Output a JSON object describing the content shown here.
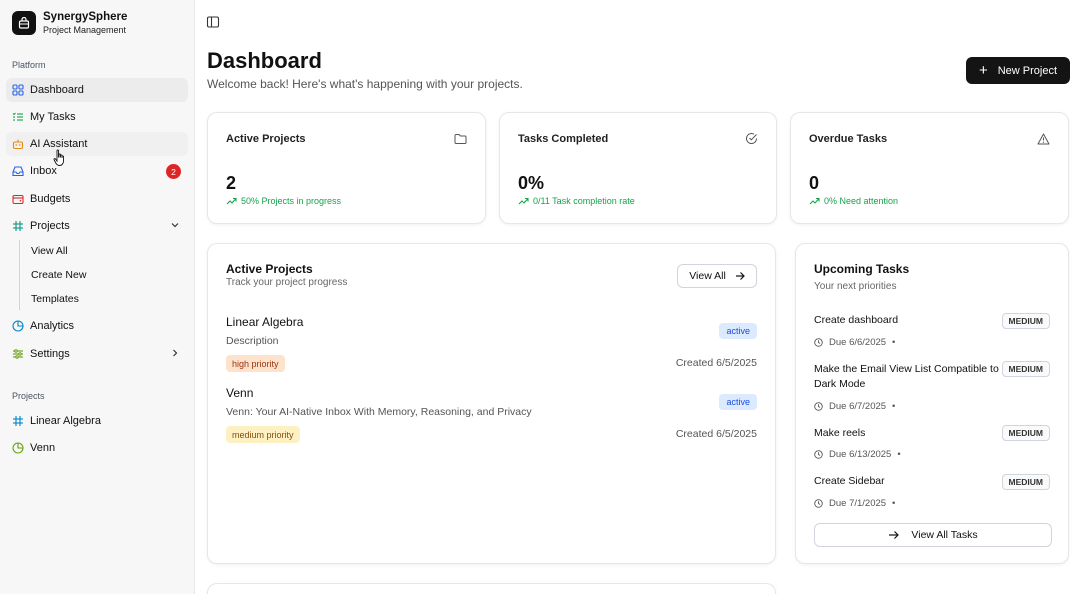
{
  "brand": {
    "name": "SynergySphere",
    "subtitle": "Project Management"
  },
  "sidebar": {
    "platform_label": "Platform",
    "items": [
      {
        "label": "Dashboard",
        "icon": "grid-icon"
      },
      {
        "label": "My Tasks",
        "icon": "list-icon"
      },
      {
        "label": "AI Assistant",
        "icon": "bot-icon"
      },
      {
        "label": "Inbox",
        "icon": "inbox-icon",
        "badge": "2"
      },
      {
        "label": "Budgets",
        "icon": "wallet-icon"
      },
      {
        "label": "Projects",
        "icon": "hash-icon"
      },
      {
        "label": "Analytics",
        "icon": "pie-icon"
      },
      {
        "label": "Settings",
        "icon": "sliders-icon"
      }
    ],
    "projects_sub": [
      "View All",
      "Create New",
      "Templates"
    ],
    "projects_label": "Projects",
    "projects": [
      {
        "label": "Linear Algebra",
        "icon": "hash-icon"
      },
      {
        "label": "Venn",
        "icon": "pie-icon"
      }
    ]
  },
  "header": {
    "title": "Dashboard",
    "subtitle": "Welcome back! Here's what's happening with your projects.",
    "new_project": "New Project"
  },
  "stats": [
    {
      "title": "Active Projects",
      "value": "2",
      "note": "50% Projects in progress",
      "icon": "folder-icon"
    },
    {
      "title": "Tasks Completed",
      "value": "0%",
      "note": "0/11 Task completion rate",
      "icon": "check-circle-icon"
    },
    {
      "title": "Overdue Tasks",
      "value": "0",
      "note": "0% Need attention",
      "icon": "warning-icon"
    }
  ],
  "active_projects": {
    "title": "Active Projects",
    "subtitle": "Track your project progress",
    "view_all": "View All",
    "items": [
      {
        "name": "Linear Algebra",
        "description": "Description",
        "priority": "high priority",
        "status": "active",
        "created": "Created 6/5/2025"
      },
      {
        "name": "Venn",
        "description": "Venn: Your AI-Native Inbox With Memory, Reasoning, and Privacy",
        "priority": "medium priority",
        "status": "active",
        "created": "Created 6/5/2025"
      }
    ]
  },
  "upcoming": {
    "title": "Upcoming Tasks",
    "subtitle": "Your next priorities",
    "view_all": "View All Tasks",
    "tasks": [
      {
        "name": "Create dashboard",
        "due": "Due 6/6/2025",
        "priority": "MEDIUM"
      },
      {
        "name": "Make the Email View List Compatible to Dark Mode",
        "due": "Due 6/7/2025",
        "priority": "MEDIUM"
      },
      {
        "name": "Make reels",
        "due": "Due 6/13/2025",
        "priority": "MEDIUM"
      },
      {
        "name": "Create Sidebar",
        "due": "Due 7/1/2025",
        "priority": "MEDIUM"
      }
    ]
  },
  "colors": {
    "accent": "#141414",
    "success": "#16a34a",
    "badge": "#dc2626",
    "status_bg": "#dbeafe"
  }
}
